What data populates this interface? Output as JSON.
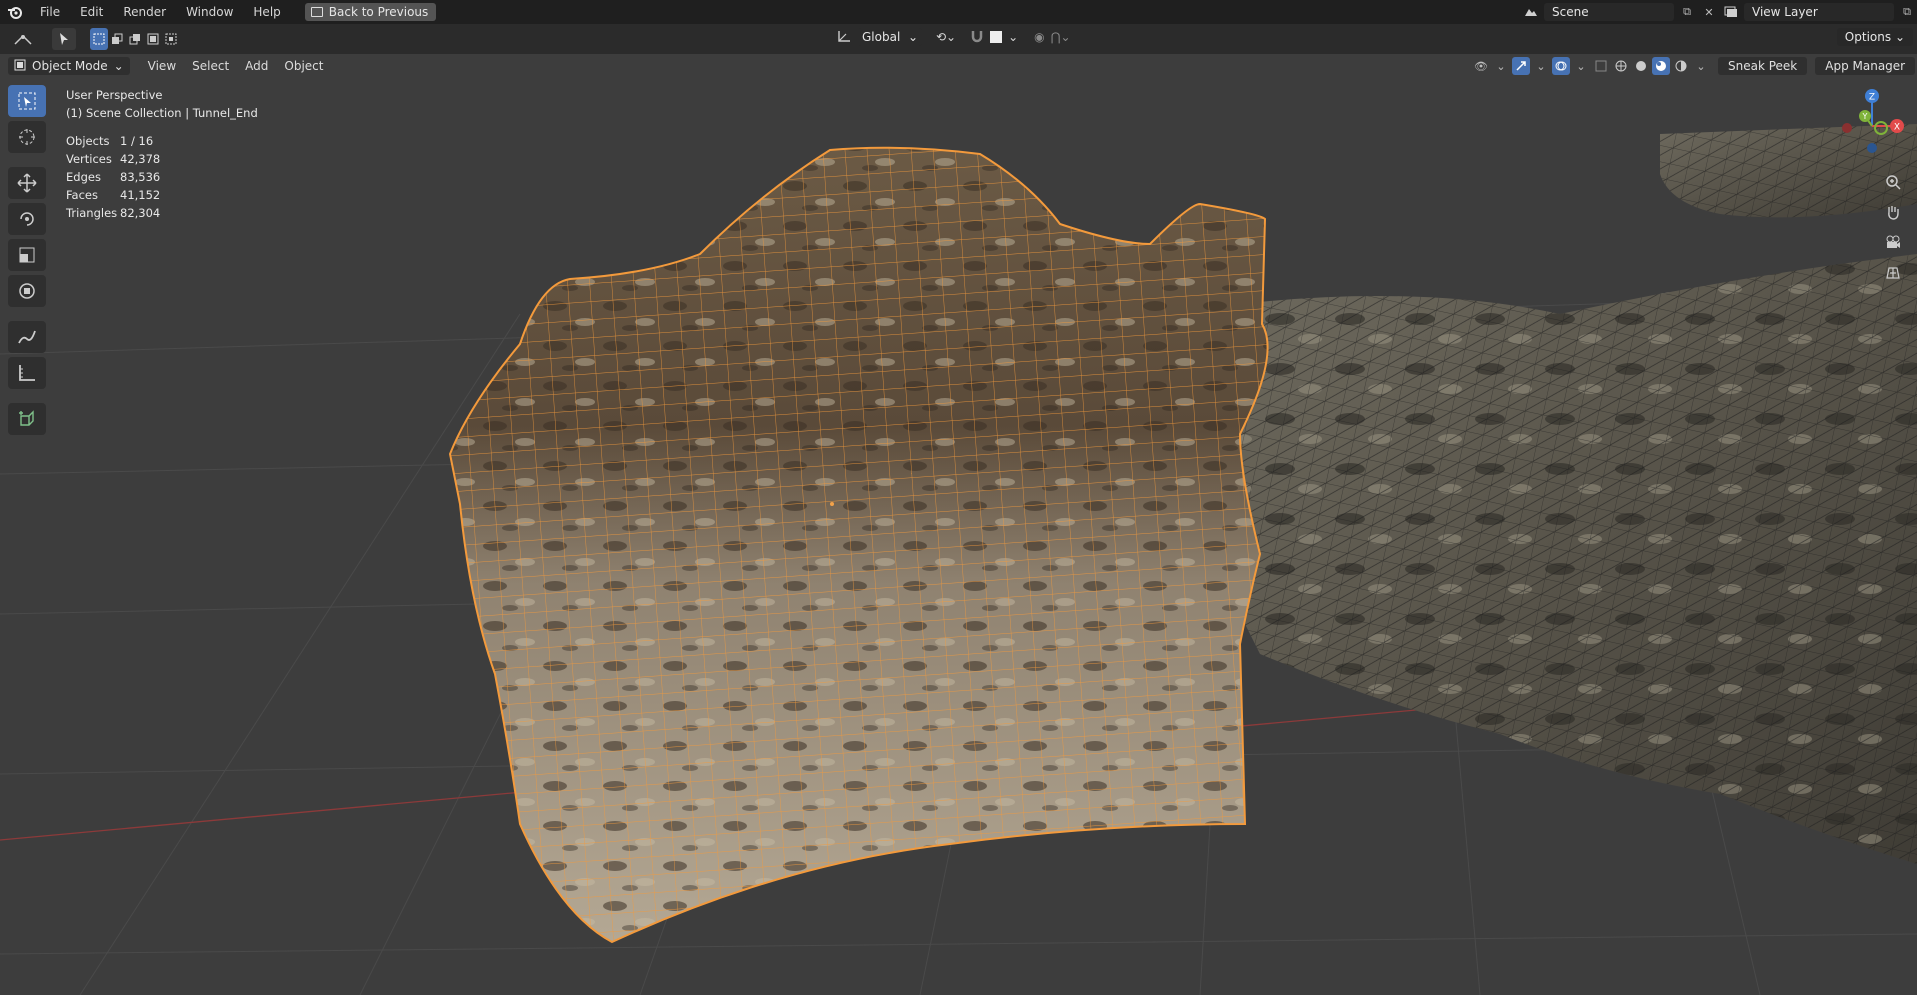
{
  "menubar": {
    "items": [
      "File",
      "Edit",
      "Render",
      "Window",
      "Help"
    ],
    "back_button": "Back to Previous",
    "scene_name": "Scene",
    "view_layer": "View Layer"
  },
  "toolbar": {
    "transform_orientation": "Global",
    "options_label": "Options"
  },
  "viewport_header": {
    "mode": "Object Mode",
    "menus": [
      "View",
      "Select",
      "Add",
      "Object"
    ],
    "sneak_peek": "Sneak Peek",
    "app_manager": "App Manager"
  },
  "overlay": {
    "perspective": "User Perspective",
    "collection": "(1) Scene Collection | Tunnel_End",
    "stats": [
      {
        "label": "Objects",
        "value": "1 / 16"
      },
      {
        "label": "Vertices",
        "value": "42,378"
      },
      {
        "label": "Edges",
        "value": "83,536"
      },
      {
        "label": "Faces",
        "value": "41,152"
      },
      {
        "label": "Triangles",
        "value": "82,304"
      }
    ]
  },
  "gizmo": {
    "axes": [
      "X",
      "Y",
      "Z"
    ],
    "colors": {
      "x": "#e24a4a",
      "y": "#7fb33a",
      "z": "#3f7fd6"
    }
  },
  "colors": {
    "accent": "#4772b3",
    "selection_outline": "#f39a3c",
    "grid_x_axis": "#8c3a3a"
  }
}
